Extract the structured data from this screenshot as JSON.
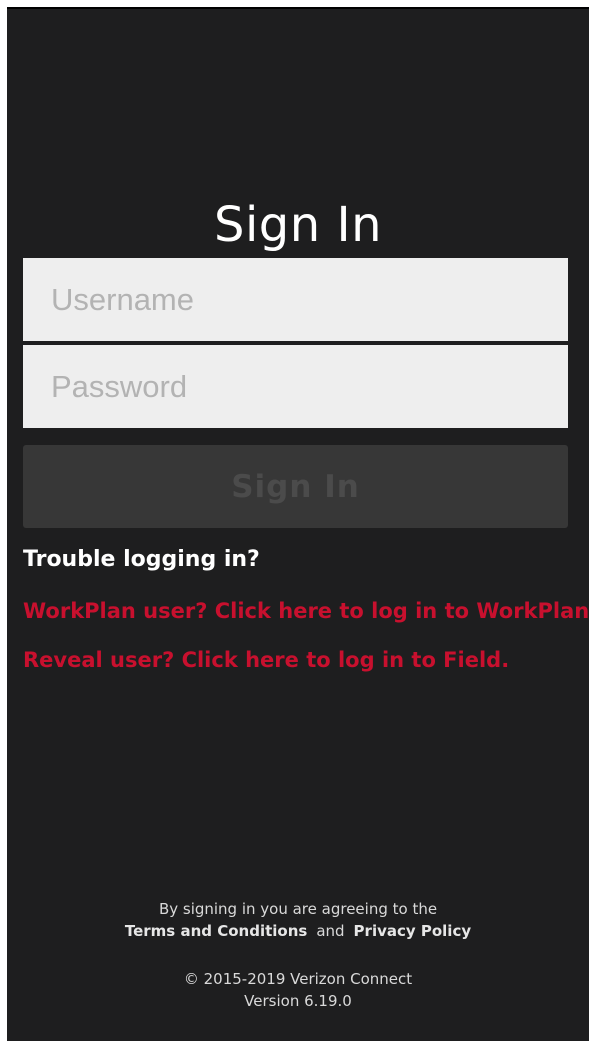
{
  "header": {
    "title": "Sign In"
  },
  "form": {
    "username_placeholder": "Username",
    "password_placeholder": "Password",
    "submit_label": "Sign In"
  },
  "help": {
    "trouble": "Trouble logging in?",
    "workplan_link": "WorkPlan user? Click here to log in to WorkPlan.",
    "field_link": "Reveal user? Click here to log in to Field."
  },
  "legal": {
    "agree_text": "By signing in you are agreeing to the",
    "terms": "Terms and Conditions",
    "and": "and",
    "privacy": "Privacy Policy"
  },
  "footer": {
    "copyright": "© 2015-2019 Verizon Connect",
    "version": "Version 6.19.0"
  },
  "colors": {
    "background": "#1e1e1f",
    "field_bg": "#eeeeee",
    "button_bg": "#373737",
    "link": "#c8102e"
  }
}
